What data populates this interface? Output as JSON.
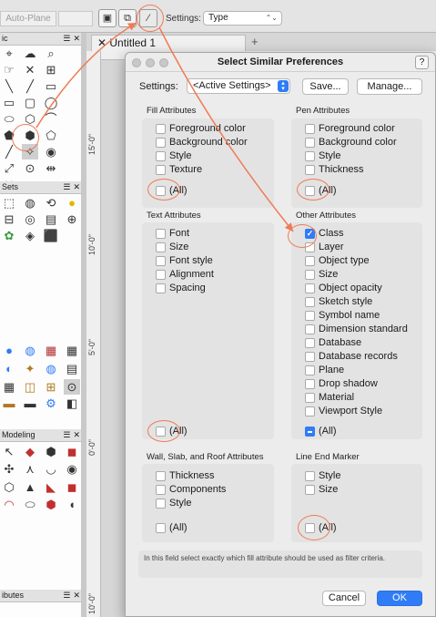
{
  "toolbar": {
    "auto_plane": "Auto-Plane",
    "settings_label": "Settings:",
    "type_value": "Type",
    "icons": [
      "mode-1-icon",
      "mode-2-icon",
      "magic-wand-settings-icon"
    ]
  },
  "palettes": {
    "basic_header": "ic",
    "sets_header": "Sets",
    "modeling_header": "Modeling",
    "attributes_header": "ibutes"
  },
  "document": {
    "tab_label": "Untitled 1",
    "ruler_labels": [
      "15'-0\"",
      "10'-0\"",
      "5'-0\"",
      "0'-0\"",
      "10'-0\""
    ]
  },
  "dialog": {
    "title": "Select Similar Preferences",
    "help": "?",
    "settings_label": "Settings:",
    "settings_value": "<Active Settings>",
    "save_button": "Save...",
    "manage_button": "Manage...",
    "fill": {
      "title": "Fill Attributes",
      "items": [
        "Foreground color",
        "Background color",
        "Style",
        "Texture"
      ],
      "all": "(All)"
    },
    "pen": {
      "title": "Pen Attributes",
      "items": [
        "Foreground color",
        "Background color",
        "Style",
        "Thickness"
      ],
      "all": "(All)"
    },
    "text": {
      "title": "Text Attributes",
      "items": [
        "Font",
        "Size",
        "Font style",
        "Alignment",
        "Spacing"
      ],
      "all": "(All)"
    },
    "other": {
      "title": "Other Attributes",
      "items": [
        "Class",
        "Layer",
        "Object type",
        "Size",
        "Object opacity",
        "Sketch style",
        "Symbol name",
        "Dimension standard",
        "Database",
        "Database records",
        "Plane",
        "Drop shadow",
        "Material",
        "Viewport Style"
      ],
      "checked": [
        "Class"
      ],
      "all": "(All)"
    },
    "wall": {
      "title": "Wall, Slab, and Roof Attributes",
      "items": [
        "Thickness",
        "Components",
        "Style"
      ],
      "all": "(All)"
    },
    "lineend": {
      "title": "Line End Marker",
      "items": [
        "Style",
        "Size"
      ],
      "all": "(All)"
    },
    "hint": "In this field select exactly which fill attribute should be used as filter criteria.",
    "cancel": "Cancel",
    "ok": "OK"
  },
  "colors": {
    "accent": "#2f7cf6",
    "annotation": "#f07a55"
  }
}
